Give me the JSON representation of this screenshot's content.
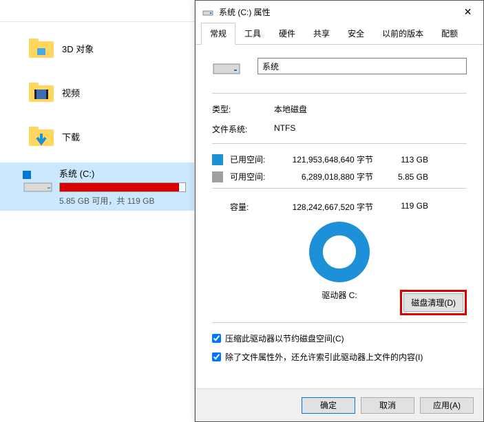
{
  "explorer": {
    "folders": [
      {
        "label": "3D 对象"
      },
      {
        "label": "视频"
      },
      {
        "label": "下载"
      }
    ],
    "drive": {
      "label": "系统 (C:)",
      "sub": "5.85 GB 可用，共 119 GB"
    }
  },
  "dialog": {
    "title": "系统 (C:) 属性",
    "tabs": [
      "常规",
      "工具",
      "硬件",
      "共享",
      "安全",
      "以前的版本",
      "配额"
    ],
    "active_tab": "常规",
    "drive_name": "系统",
    "type_label": "类型:",
    "type_value": "本地磁盘",
    "fs_label": "文件系统:",
    "fs_value": "NTFS",
    "used_label": "已用空间:",
    "used_bytes": "121,953,648,640 字节",
    "used_size": "113 GB",
    "free_label": "可用空间:",
    "free_bytes": "6,289,018,880 字节",
    "free_size": "5.85 GB",
    "capacity_label": "容量:",
    "capacity_bytes": "128,242,667,520 字节",
    "capacity_size": "119 GB",
    "drive_caption": "驱动器 C:",
    "cleanup": "磁盘清理(D)",
    "compress": "压缩此驱动器以节约磁盘空间(C)",
    "index": "除了文件属性外，还允许索引此驱动器上文件的内容(I)",
    "ok": "确定",
    "cancel": "取消",
    "apply": "应用(A)"
  },
  "chart_data": {
    "type": "pie",
    "title": "驱动器 C:",
    "series": [
      {
        "name": "已用空间",
        "value": 121953648640,
        "color": "#1e90d8"
      },
      {
        "name": "可用空间",
        "value": 6289018880,
        "color": "#a0a0a0"
      }
    ]
  }
}
